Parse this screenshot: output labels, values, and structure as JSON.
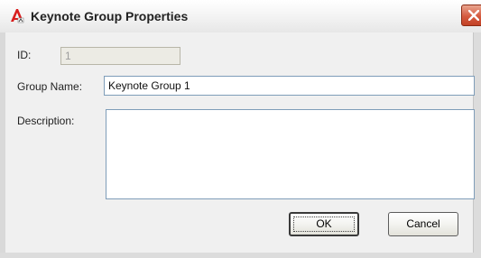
{
  "window": {
    "title": "Keynote Group Properties",
    "app_icon": "autocad-icon",
    "close_icon": "close-icon"
  },
  "form": {
    "id_label": "ID:",
    "id_value": "1",
    "group_name_label": "Group Name:",
    "group_name_value": "Keynote Group 1",
    "description_label": "Description:",
    "description_value": ""
  },
  "buttons": {
    "ok_label": "OK",
    "cancel_label": "Cancel"
  },
  "colors": {
    "close_button": "#d55a3f",
    "window_background": "#ece9d8",
    "field_border": "#7f9db9"
  }
}
